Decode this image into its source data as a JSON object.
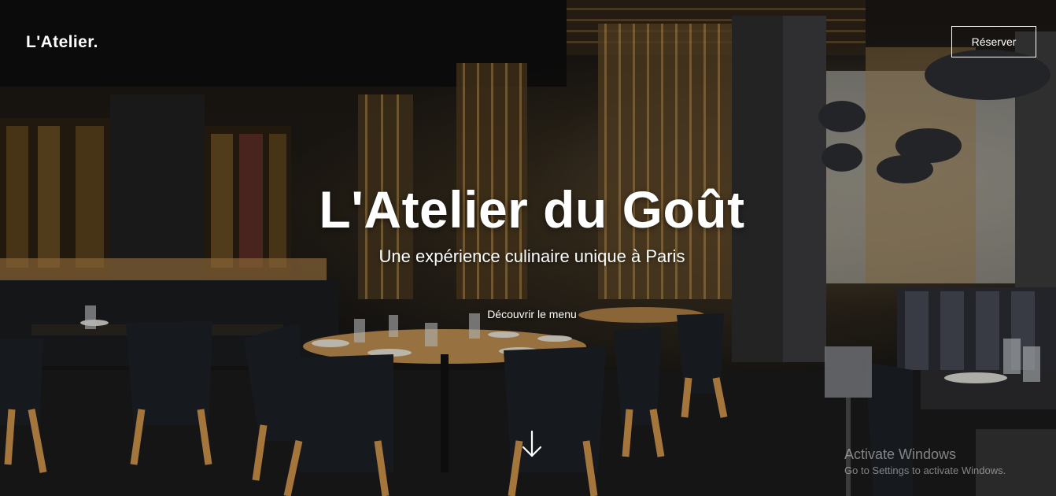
{
  "header": {
    "brand": "L'Atelier.",
    "reserve_label": "Réserver"
  },
  "hero": {
    "title": "L'Atelier du Goût",
    "subtitle": "Une expérience culinaire unique à Paris",
    "menu_link": "Découvrir le menu",
    "scroll_icon": "arrow-down-icon",
    "background_image": "restaurant-interior-photo"
  },
  "watermark": {
    "title": "Activate Windows",
    "subtitle": "Go to Settings to activate Windows."
  },
  "colors": {
    "text": "#ffffff",
    "wood": "#b98a4e",
    "chair": "#1c2026",
    "watermark": "#dcdcdc"
  }
}
